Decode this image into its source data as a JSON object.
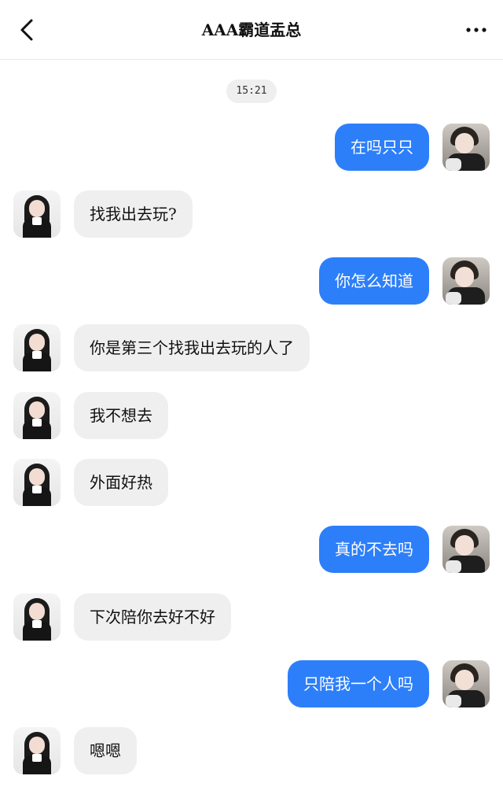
{
  "header": {
    "title": "AAA霸道盂总",
    "back_icon": "chevron-left-icon",
    "more_icon": "more-horizontal-icon"
  },
  "chat": {
    "timestamp": "15:21",
    "messages": [
      {
        "side": "right",
        "text": "在吗只只"
      },
      {
        "side": "left",
        "text": "找我出去玩?"
      },
      {
        "side": "right",
        "text": "你怎么知道"
      },
      {
        "side": "left",
        "text": "你是第三个找我出去玩的人了"
      },
      {
        "side": "left",
        "text": "我不想去"
      },
      {
        "side": "left",
        "text": "外面好热"
      },
      {
        "side": "right",
        "text": "真的不去吗"
      },
      {
        "side": "left",
        "text": "下次陪你去好不好"
      },
      {
        "side": "right",
        "text": "只陪我一个人吗"
      },
      {
        "side": "left",
        "text": "嗯嗯"
      }
    ]
  },
  "colors": {
    "sent_bubble": "#2d7ff9",
    "received_bubble": "#efefef",
    "background": "#ffffff"
  }
}
